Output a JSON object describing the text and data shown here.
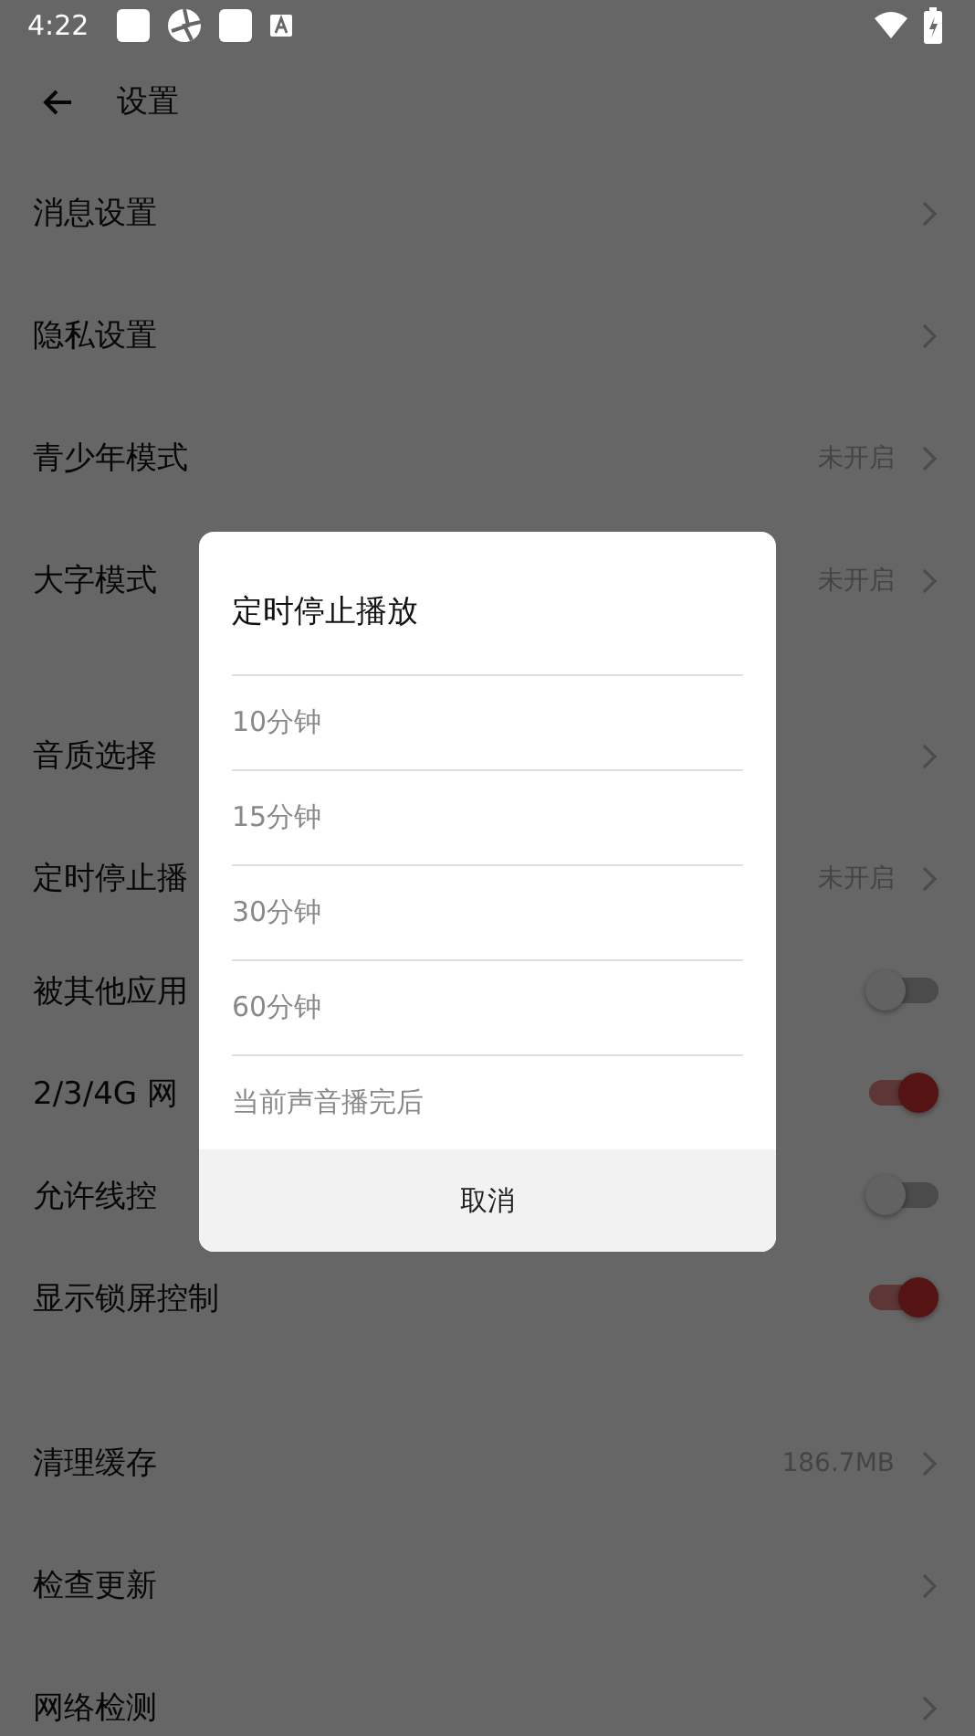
{
  "status_bar": {
    "time": "4:22"
  },
  "header": {
    "title": "设置"
  },
  "sections": [
    {
      "rows": [
        {
          "kind": "link",
          "label": "消息设置"
        },
        {
          "kind": "link",
          "label": "隐私设置"
        },
        {
          "kind": "link",
          "label": "青少年模式",
          "value": "未开启"
        },
        {
          "kind": "link",
          "label": "大字模式",
          "value": "未开启"
        }
      ]
    },
    {
      "rows": [
        {
          "kind": "link",
          "label": "音质选择"
        },
        {
          "kind": "link",
          "label": "定时停止播",
          "value": "未开启"
        },
        {
          "kind": "toggle",
          "label": "被其他应用",
          "on": false
        },
        {
          "kind": "toggle",
          "label": "2/3/4G 网",
          "on": true
        },
        {
          "kind": "toggle",
          "label": "允许线控",
          "on": false
        },
        {
          "kind": "toggle",
          "label": "显示锁屏控制",
          "on": true
        }
      ]
    },
    {
      "rows": [
        {
          "kind": "link",
          "label": "清理缓存",
          "value": "186.7MB"
        },
        {
          "kind": "link",
          "label": "检查更新"
        },
        {
          "kind": "link",
          "label": "网络检测"
        }
      ]
    }
  ],
  "dialog": {
    "title": "定时停止播放",
    "options": [
      "10分钟",
      "15分钟",
      "30分钟",
      "60分钟",
      "当前声音播完后"
    ],
    "cancel": "取消"
  }
}
